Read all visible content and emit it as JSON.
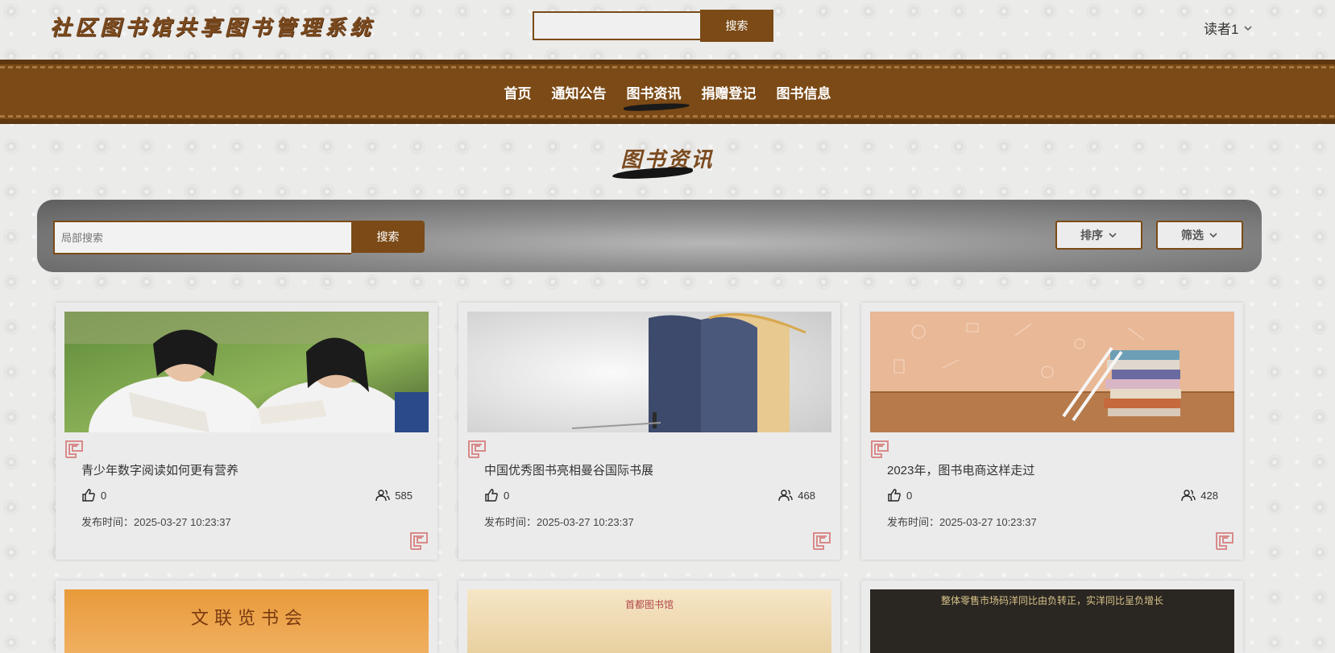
{
  "header": {
    "site_title": "社区图书馆共享图书管理系统",
    "search_button": "搜索",
    "user_name": "读者1"
  },
  "nav": {
    "items": [
      {
        "label": "首页"
      },
      {
        "label": "通知公告"
      },
      {
        "label": "图书资讯",
        "active": true
      },
      {
        "label": "捐赠登记"
      },
      {
        "label": "图书信息"
      }
    ]
  },
  "page": {
    "title": "图书资讯"
  },
  "toolbar": {
    "search_placeholder": "局部搜索",
    "search_button": "搜索",
    "sort_label": "排序",
    "filter_label": "筛选"
  },
  "cards": [
    {
      "title": "青少年数字阅读如何更有营养",
      "likes": "0",
      "views": "585",
      "time": "发布时间：2025-03-27 10:23:37"
    },
    {
      "title": "中国优秀图书亮相曼谷国际书展",
      "likes": "0",
      "views": "468",
      "time": "发布时间：2025-03-27 10:23:37"
    },
    {
      "title": "2023年，图书电商这样走过",
      "likes": "0",
      "views": "428",
      "time": "发布时间：2025-03-27 10:23:37"
    }
  ],
  "partial_cards": [
    {
      "image_text": "文 联 览 书 会"
    },
    {
      "image_text": "首都图书馆"
    },
    {
      "image_text": "整体零售市场码洋同比由负转正，实洋同比呈负增长"
    }
  ],
  "colors": {
    "brand": "#7b4a16",
    "brand_dark": "#5f3810",
    "accent_motif": "#d98a8a"
  },
  "icons": {
    "user_dropdown": "chevron-down-icon",
    "like": "thumbs-up-icon",
    "views": "users-icon",
    "motif": "fret-motif-icon"
  }
}
